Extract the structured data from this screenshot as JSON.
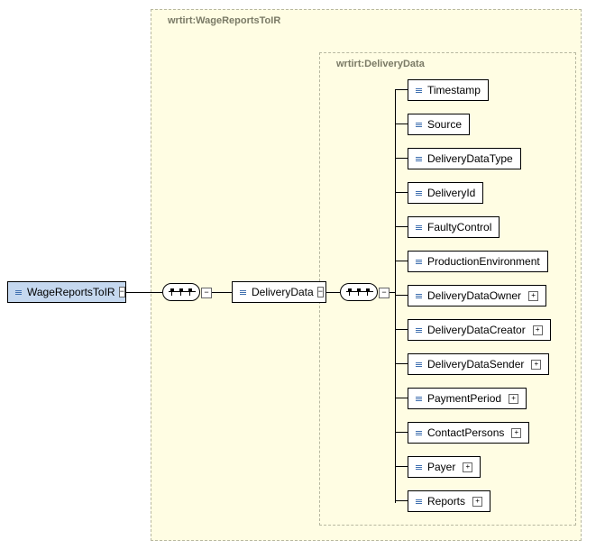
{
  "outerFrame": {
    "label": "wrtirt:WageReportsToIR"
  },
  "innerFrame": {
    "label": "wrtirt:DeliveryData"
  },
  "root": {
    "label": "WageReportsToIR"
  },
  "midNode": {
    "label": "DeliveryData"
  },
  "children": [
    {
      "label": "Timestamp",
      "expandable": false
    },
    {
      "label": "Source",
      "expandable": false
    },
    {
      "label": "DeliveryDataType",
      "expandable": false
    },
    {
      "label": "DeliveryId",
      "expandable": false
    },
    {
      "label": "FaultyControl",
      "expandable": false
    },
    {
      "label": "ProductionEnvironment",
      "expandable": false
    },
    {
      "label": "DeliveryDataOwner",
      "expandable": true
    },
    {
      "label": "DeliveryDataCreator",
      "expandable": true
    },
    {
      "label": "DeliveryDataSender",
      "expandable": true
    },
    {
      "label": "PaymentPeriod",
      "expandable": true
    },
    {
      "label": "ContactPersons",
      "expandable": true
    },
    {
      "label": "Payer",
      "expandable": true
    },
    {
      "label": "Reports",
      "expandable": true
    }
  ]
}
